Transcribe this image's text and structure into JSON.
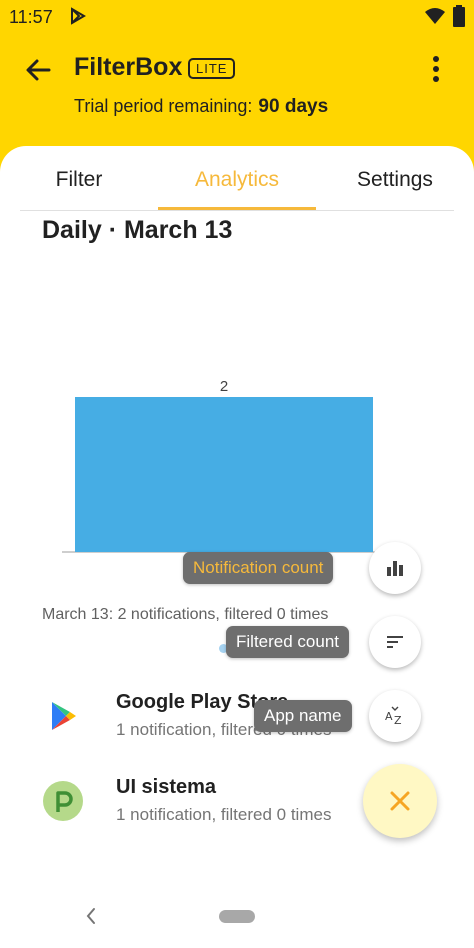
{
  "status_bar": {
    "time": "11:57"
  },
  "app_bar": {
    "title": "FilterBox",
    "badge": "LITE",
    "trial_label": "Trial period remaining:",
    "trial_value": "90 days",
    "back_icon": "arrow-back-icon",
    "menu_icon": "more-vert-icon"
  },
  "tabs": [
    {
      "label": "Filter",
      "active": false
    },
    {
      "label": "Analytics",
      "active": true
    },
    {
      "label": "Settings",
      "active": false
    }
  ],
  "period_title": "Daily · March 13",
  "chart_data": {
    "type": "bar",
    "categories": [
      ""
    ],
    "values": [
      2
    ],
    "data_labels": [
      "2"
    ],
    "ylim": [
      0,
      2.4
    ],
    "xlabel": "",
    "ylabel": "",
    "bar_color": "#46ADE4",
    "grid": false
  },
  "summary": "March 13: 2 notifications, filtered 0 times",
  "apps": [
    {
      "name": "Google Play Store",
      "subtitle": "1 notification, filtered 0 times",
      "icon": "google-play-icon"
    },
    {
      "name": "UI sistema",
      "subtitle": "1 notification, filtered 0 times",
      "icon": "android-p-icon"
    }
  ],
  "sort_menu": {
    "options": [
      {
        "label": "Notification count",
        "icon": "bar-chart-icon",
        "selected": true
      },
      {
        "label": "Filtered count",
        "icon": "sort-icon",
        "selected": false
      },
      {
        "label": "App name",
        "icon": "sort-az-icon",
        "selected": false
      }
    ],
    "close_icon": "close-icon"
  },
  "colors": {
    "accent": "#F6B93B",
    "toolbar": "#FFD600",
    "bar": "#46ADE4"
  }
}
